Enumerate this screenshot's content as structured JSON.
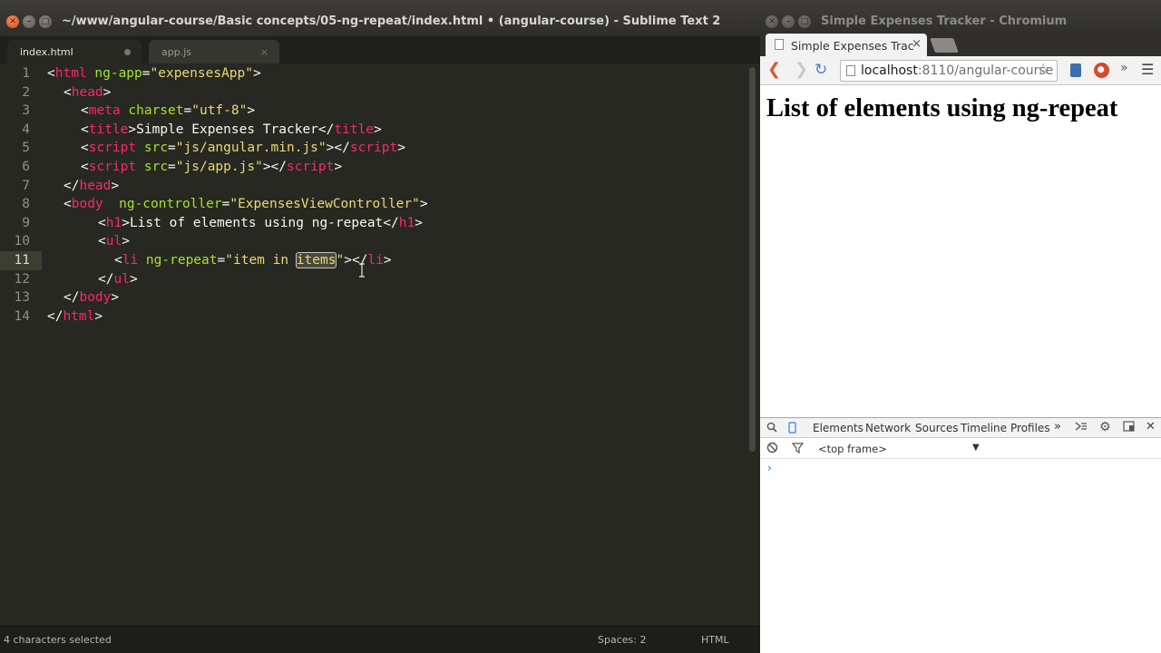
{
  "sublime": {
    "window_title": "~/www/angular-course/Basic concepts/05-ng-repeat/index.html • (angular-course) - Sublime Text 2",
    "tabs": [
      {
        "label": "index.html",
        "modified": true
      },
      {
        "label": "app.js",
        "modified": false
      }
    ],
    "line_numbers": [
      "1",
      "2",
      "3",
      "4",
      "5",
      "6",
      "7",
      "8",
      "9",
      "10",
      "11",
      "12",
      "13",
      "14"
    ],
    "current_line": "11",
    "code": {
      "l1": {
        "o": "<",
        "tag": "html",
        "a1": " ng-app",
        "eq": "=",
        "s1": "\"expensesApp\"",
        "c": ">"
      },
      "l2": {
        "o": "<",
        "tag": "head",
        "c": ">"
      },
      "l3": {
        "o": "<",
        "tag": "meta",
        "a1": " charset",
        "eq": "=",
        "s1": "\"utf-8\"",
        "c": ">"
      },
      "l4": {
        "o": "<",
        "tag": "title",
        "c": ">",
        "text": "Simple Expenses Tracker",
        "o2": "</",
        "tag2": "title",
        "c2": ">"
      },
      "l5": {
        "o": "<",
        "tag": "script",
        "a1": " src",
        "eq": "=",
        "s1": "\"js/angular.min.js\"",
        "c": ">",
        "o2": "</",
        "tag2": "script",
        "c2": ">"
      },
      "l6": {
        "o": "<",
        "tag": "script",
        "a1": " src",
        "eq": "=",
        "s1": "\"js/app.js\"",
        "c": ">",
        "o2": "</",
        "tag2": "script",
        "c2": ">"
      },
      "l7": {
        "o": "</",
        "tag": "head",
        "c": ">"
      },
      "l8": {
        "o": "<",
        "tag": "body",
        "a1": "  ng-controller",
        "eq": "=",
        "s1": "\"ExpensesViewController\"",
        "c": ">"
      },
      "l9": {
        "o": "<",
        "tag": "h1",
        "c": ">",
        "text": "List of elements using ng-repeat",
        "o2": "</",
        "tag2": "h1",
        "c2": ">"
      },
      "l10": {
        "o": "<",
        "tag": "ul",
        "c": ">"
      },
      "l11": {
        "o": "<",
        "tag": "li",
        "a1": " ng-repeat",
        "eq": "=",
        "s_pre": "\"item in ",
        "s_sel": "items",
        "s_post": "\"",
        "c": ">",
        "o2": "</",
        "tag2": "li",
        "c2": ">"
      },
      "l12": {
        "o": "</",
        "tag": "ul",
        "c": ">"
      },
      "l13": {
        "o": "</",
        "tag": "body",
        "c": ">"
      },
      "l14": {
        "o": "</",
        "tag": "html",
        "c": ">"
      }
    },
    "status": {
      "selection": "4 characters selected",
      "indent": "Spaces: 2",
      "syntax": "HTML"
    }
  },
  "chromium": {
    "window_title": "Simple Expenses Tracker - Chromium",
    "tab_title": "Simple Expenses Trac",
    "tab_close": "×",
    "url_host": "localhost",
    "url_path": ":8110/angular-course",
    "page_heading": "List of elements using ng-repeat",
    "devtools": {
      "tabs": [
        "Elements",
        "Network",
        "Sources",
        "Timeline",
        "Profiles"
      ],
      "overflow": "»",
      "frame_selector": "<top frame>",
      "frame_arrow": "▼",
      "console_prompt": "›"
    }
  },
  "icons": {
    "sublime_wm": [
      "close-icon",
      "minimize-icon",
      "maximize-icon"
    ],
    "chromium_toolbar": [
      "back-icon",
      "forward-icon",
      "reload-icon",
      "star-icon",
      "extension-icon",
      "extension-icon-2",
      "menu-icon"
    ],
    "devtools": [
      "search-icon",
      "device-mode-icon",
      "console-drawer-icon",
      "settings-gear-icon",
      "dock-icon",
      "close-icon",
      "clear-console-icon",
      "filter-icon"
    ]
  },
  "colors": {
    "editor_bg": "#272822",
    "tag": "#f92672",
    "attribute": "#a6e22e",
    "string": "#e6db74"
  }
}
